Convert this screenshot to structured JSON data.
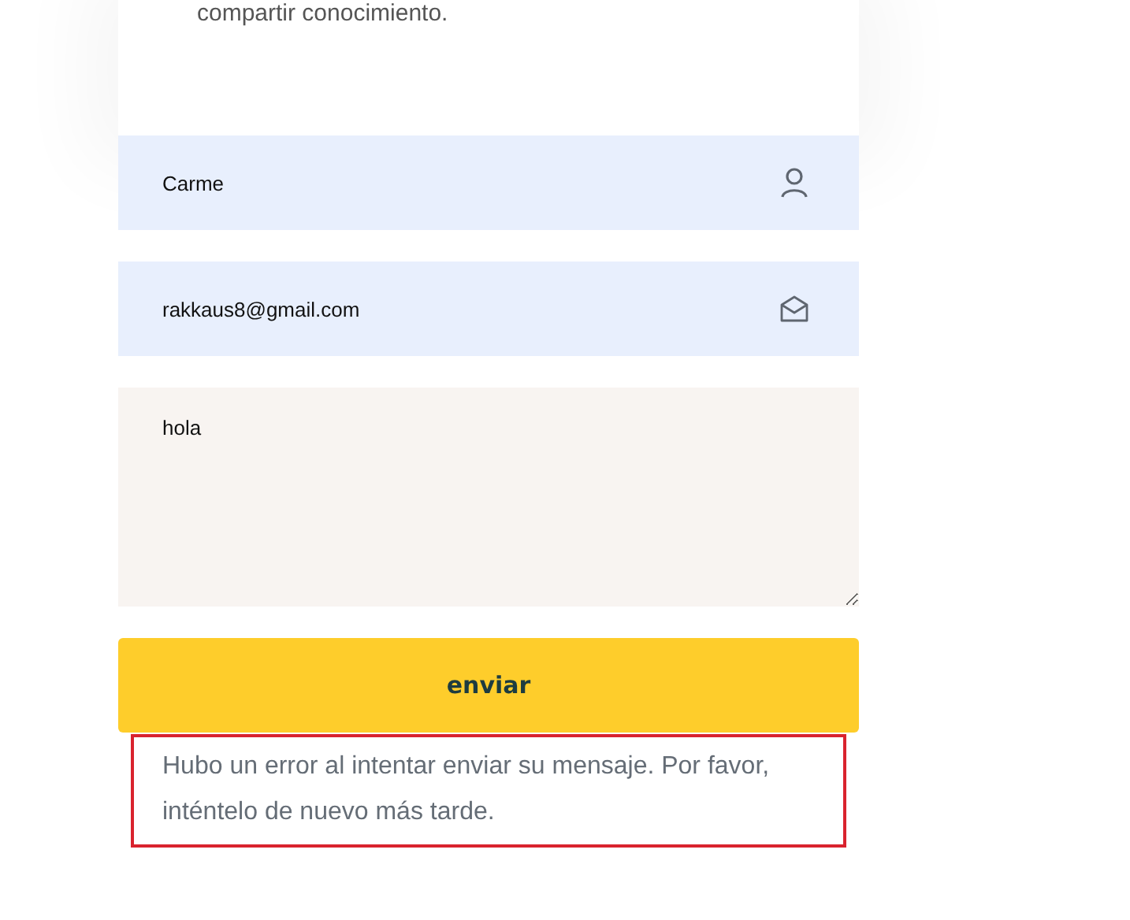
{
  "card": {
    "text": "compartir conocimiento."
  },
  "fields": [
    {
      "kind": "name",
      "value": "Carme"
    },
    {
      "kind": "email",
      "value": "rakkaus8@gmail.com"
    }
  ],
  "message": {
    "value": "hola"
  },
  "submit": {
    "label": "enviar"
  },
  "error": {
    "text": "Hubo un error al intentar enviar su mensaje. Por favor, inténtelo de nuevo más tarde."
  }
}
